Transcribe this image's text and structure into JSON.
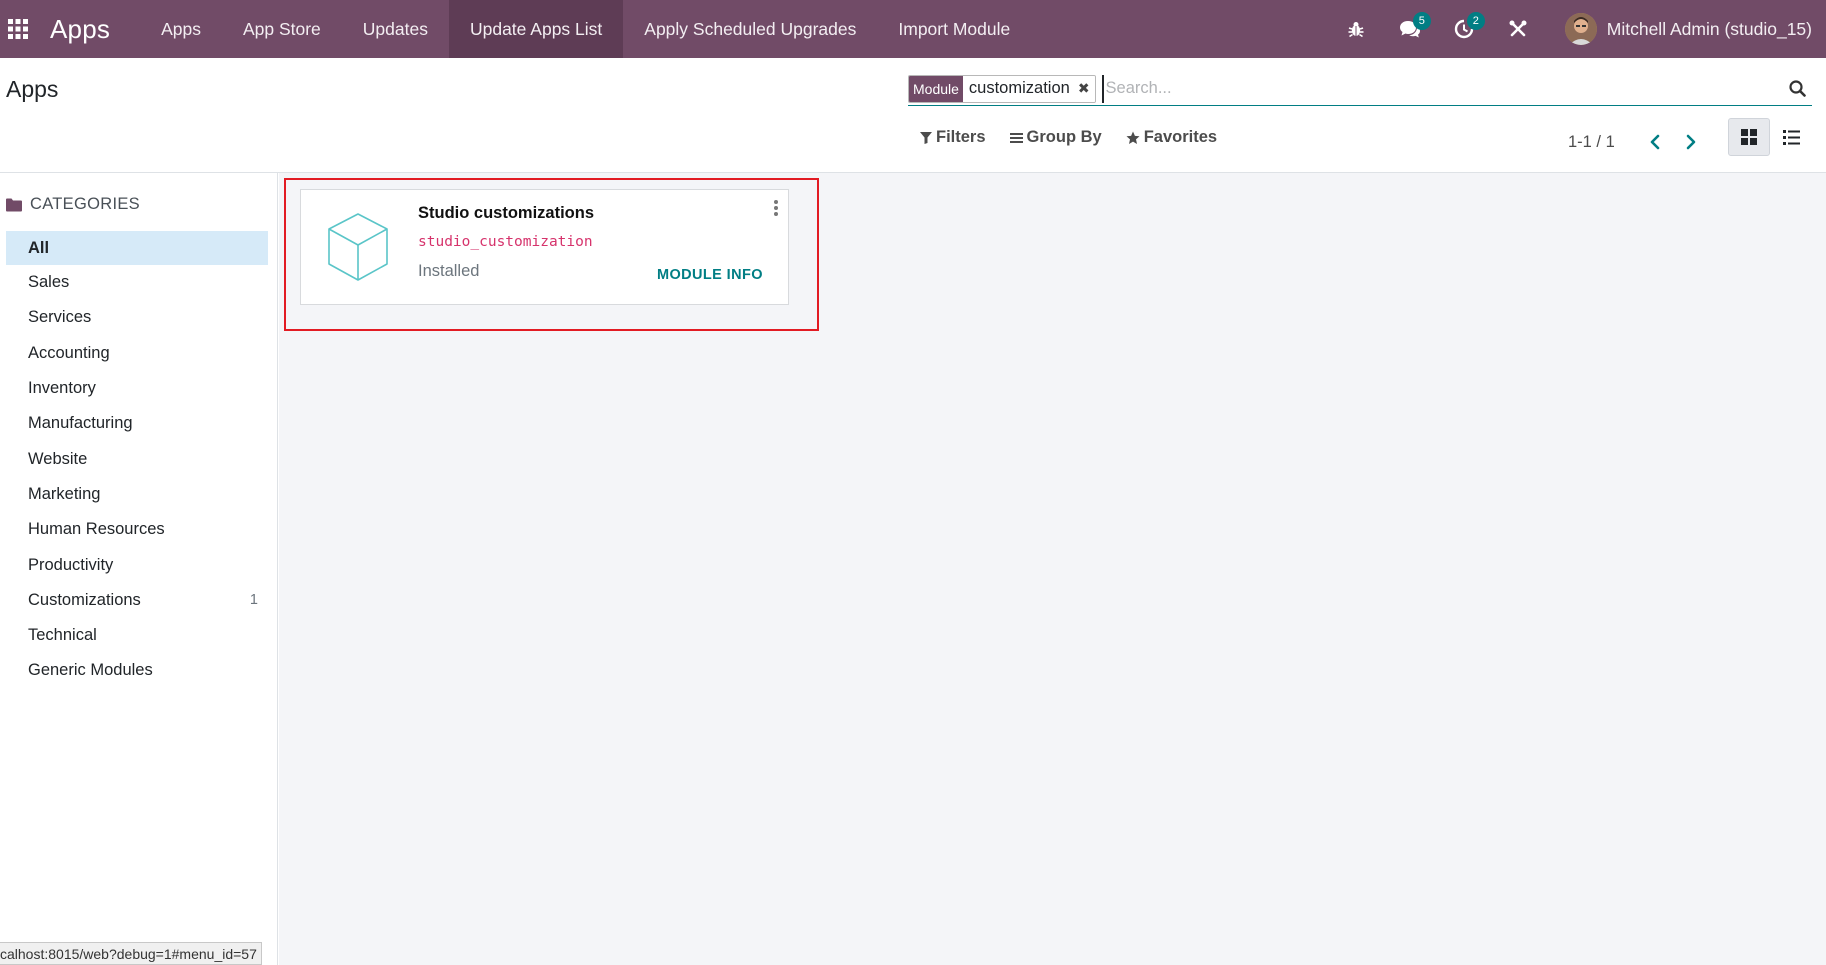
{
  "navbar": {
    "brand": "Apps",
    "menu": [
      {
        "label": "Apps",
        "active": false
      },
      {
        "label": "App Store",
        "active": false
      },
      {
        "label": "Updates",
        "active": false
      },
      {
        "label": "Update Apps List",
        "active": true
      },
      {
        "label": "Apply Scheduled Upgrades",
        "active": false
      },
      {
        "label": "Import Module",
        "active": false
      }
    ],
    "icons": [
      "apps-grid-icon",
      "bug-icon",
      "chat-icon",
      "activity-clock-icon",
      "tools-icon"
    ],
    "messages_badge": "5",
    "activities_badge": "2",
    "user_name": "Mitchell Admin (studio_15)",
    "color": "#714B67"
  },
  "control_panel": {
    "title": "Apps",
    "search": {
      "facet_label": "Module",
      "facet_value": "customization",
      "placeholder": "Search..."
    },
    "filters_label": "Filters",
    "group_by_label": "Group By",
    "favorites_label": "Favorites",
    "pager": "1-1 / 1",
    "view_active": "kanban"
  },
  "sidebar": {
    "header": "CATEGORIES",
    "items": [
      {
        "label": "All",
        "count": "",
        "active": true
      },
      {
        "label": "Sales",
        "count": ""
      },
      {
        "label": "Services",
        "count": ""
      },
      {
        "label": "Accounting",
        "count": ""
      },
      {
        "label": "Inventory",
        "count": ""
      },
      {
        "label": "Manufacturing",
        "count": ""
      },
      {
        "label": "Website",
        "count": ""
      },
      {
        "label": "Marketing",
        "count": ""
      },
      {
        "label": "Human Resources",
        "count": ""
      },
      {
        "label": "Productivity",
        "count": ""
      },
      {
        "label": "Customizations",
        "count": "1"
      },
      {
        "label": "Technical",
        "count": ""
      },
      {
        "label": "Generic Modules",
        "count": ""
      }
    ]
  },
  "card": {
    "title": "Studio customizations",
    "technical_name": "studio_customization",
    "state": "Installed",
    "info_button": "MODULE INFO",
    "highlight_color": "#e21b23"
  },
  "status_url": "calhost:8015/web?debug=1#menu_id=57"
}
